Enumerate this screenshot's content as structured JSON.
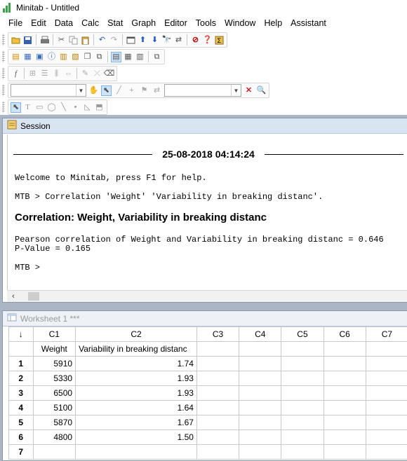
{
  "window": {
    "title": "Minitab - Untitled"
  },
  "menu": [
    "File",
    "Edit",
    "Data",
    "Calc",
    "Stat",
    "Graph",
    "Editor",
    "Tools",
    "Window",
    "Help",
    "Assistant"
  ],
  "session": {
    "title": "Session",
    "datetime": "25-08-2018 04:14:24",
    "welcome": "Welcome to Minitab, press F1 for help.",
    "command": "MTB > Correlation 'Weight' 'Variability in breaking distanc'.",
    "heading": "Correlation: Weight, Variability in breaking distanc",
    "pearson": "Pearson correlation of Weight and Variability in breaking distanc = 0.646",
    "pvalue": "P-Value = 0.165",
    "prompt": "MTB >"
  },
  "worksheet": {
    "title": "Worksheet 1 ***",
    "corner": "↓",
    "columns": [
      "C1",
      "C2",
      "C3",
      "C4",
      "C5",
      "C6",
      "C7"
    ],
    "names": [
      "Weight",
      "Variability in breaking distanc",
      "",
      "",
      "",
      "",
      ""
    ],
    "rows": [
      {
        "n": "1",
        "c1": "5910",
        "c2": "1.74"
      },
      {
        "n": "2",
        "c1": "5330",
        "c2": "1.93"
      },
      {
        "n": "3",
        "c1": "6500",
        "c2": "1.93"
      },
      {
        "n": "4",
        "c1": "5100",
        "c2": "1.64"
      },
      {
        "n": "5",
        "c1": "5870",
        "c2": "1.67"
      },
      {
        "n": "6",
        "c1": "4800",
        "c2": "1.50"
      },
      {
        "n": "7",
        "c1": "",
        "c2": ""
      }
    ]
  },
  "icons": {
    "scroll_left": "‹"
  }
}
